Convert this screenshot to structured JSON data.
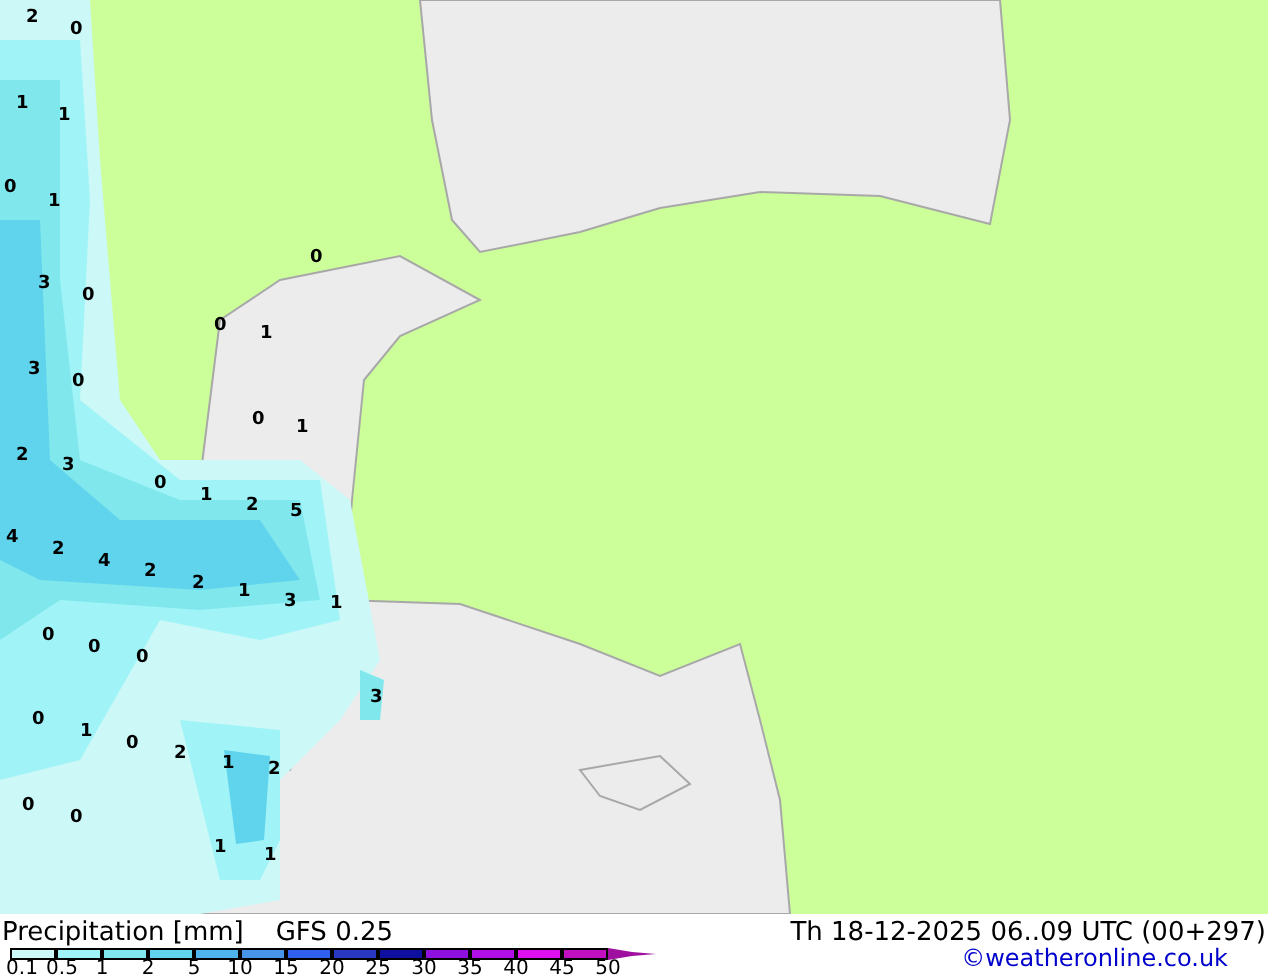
{
  "map": {
    "labels": [
      {
        "text": "2"
      },
      {
        "text": "0"
      },
      {
        "text": "1"
      },
      {
        "text": "1"
      },
      {
        "text": "0"
      },
      {
        "text": "1"
      },
      {
        "text": "3"
      },
      {
        "text": "0"
      },
      {
        "text": "3"
      },
      {
        "text": "0"
      },
      {
        "text": "2"
      },
      {
        "text": "3"
      },
      {
        "text": "0"
      },
      {
        "text": "1"
      },
      {
        "text": "2"
      },
      {
        "text": "4"
      },
      {
        "text": "2"
      },
      {
        "text": "4"
      },
      {
        "text": "2"
      },
      {
        "text": "2"
      },
      {
        "text": "1"
      },
      {
        "text": "3"
      },
      {
        "text": "1"
      },
      {
        "text": "0"
      },
      {
        "text": "0"
      },
      {
        "text": "0"
      },
      {
        "text": "0"
      },
      {
        "text": "1"
      },
      {
        "text": "0"
      },
      {
        "text": "2"
      },
      {
        "text": "1"
      },
      {
        "text": "2"
      },
      {
        "text": "0"
      },
      {
        "text": "0"
      },
      {
        "text": "1"
      },
      {
        "text": "1"
      },
      {
        "text": "0"
      },
      {
        "text": "0"
      },
      {
        "text": "1"
      },
      {
        "text": "0"
      },
      {
        "text": "1"
      },
      {
        "text": "5"
      },
      {
        "text": "3"
      }
    ]
  },
  "footer": {
    "title": "Precipitation [mm]",
    "model": "GFS 0.25",
    "valid_time": "Th 18-12-2025 06..09 UTC (00+297)",
    "credit": "©weatheronline.co.uk"
  },
  "legend": [
    {
      "label": "0.1",
      "color": "#ccf8f8"
    },
    {
      "label": "0.5",
      "color": "#a0f4f8"
    },
    {
      "label": "1",
      "color": "#80e8ec"
    },
    {
      "label": "2",
      "color": "#60d4ec"
    },
    {
      "label": "5",
      "color": "#50b4ec"
    },
    {
      "label": "10",
      "color": "#4894e8"
    },
    {
      "label": "15",
      "color": "#3060f0"
    },
    {
      "label": "20",
      "color": "#2838c0"
    },
    {
      "label": "25",
      "color": "#1010a0"
    },
    {
      "label": "30",
      "color": "#9010e0"
    },
    {
      "label": "35",
      "color": "#b010e8"
    },
    {
      "label": "40",
      "color": "#e010f0"
    },
    {
      "label": "45",
      "color": "#c010c0"
    },
    {
      "label": "50",
      "color": "#a010a0"
    }
  ]
}
